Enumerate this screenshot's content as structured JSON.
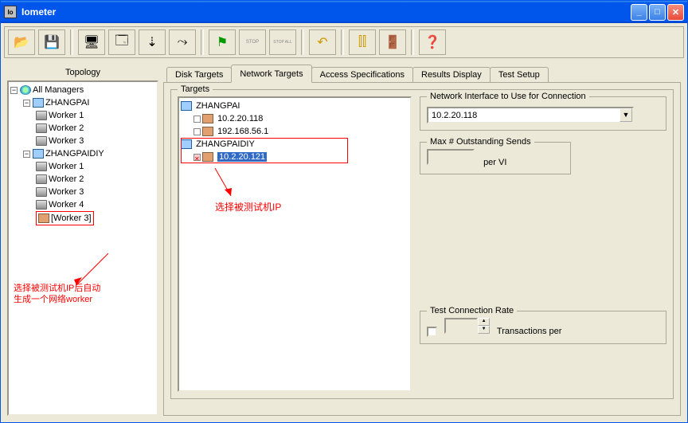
{
  "window": {
    "title": "Iometer",
    "appicon_text": "Io"
  },
  "toolbar": {
    "open": "📂",
    "save": "💾",
    "target1": "🖥",
    "target2": "🗔",
    "yellow": "⇣",
    "spread": "⤳",
    "flag": "⚑",
    "stop1": "STOP",
    "stopall": "STOP ALL",
    "undo": "↶",
    "pipes": "⫿⫿",
    "exit": "🚪",
    "help": "❓"
  },
  "topology": {
    "header": "Topology",
    "root": "All Managers",
    "hosts": [
      {
        "name": "ZHANGPAI",
        "workers": [
          "Worker 1",
          "Worker 2",
          "Worker 3"
        ]
      },
      {
        "name": "ZHANGPAIDIY",
        "workers": [
          "Worker 1",
          "Worker 2",
          "Worker 3",
          "Worker 4",
          "[Worker 3]"
        ]
      }
    ],
    "annotation": "选择被测试机IP后自动\n生成一个网络worker"
  },
  "tabs": {
    "disk": "Disk Targets",
    "network": "Network Targets",
    "access": "Access Specifications",
    "results": "Results Display",
    "setup": "Test Setup"
  },
  "targets": {
    "legend": "Targets",
    "tree": [
      {
        "host": "ZHANGPAI",
        "ips": [
          "10.2.20.118",
          "192.168.56.1"
        ]
      },
      {
        "host": "ZHANGPAIDIY",
        "ips": [
          "10.2.20.121"
        ],
        "selected": 0,
        "checkedX": 0
      }
    ],
    "annotation": "选择被测试机IP"
  },
  "netiface": {
    "legend": "Network Interface to Use for Connection",
    "value": "10.2.20.118"
  },
  "maxsends": {
    "legend": "Max # Outstanding Sends",
    "label": "per VI"
  },
  "testrate": {
    "legend": "Test Connection Rate",
    "label": "Transactions per"
  }
}
